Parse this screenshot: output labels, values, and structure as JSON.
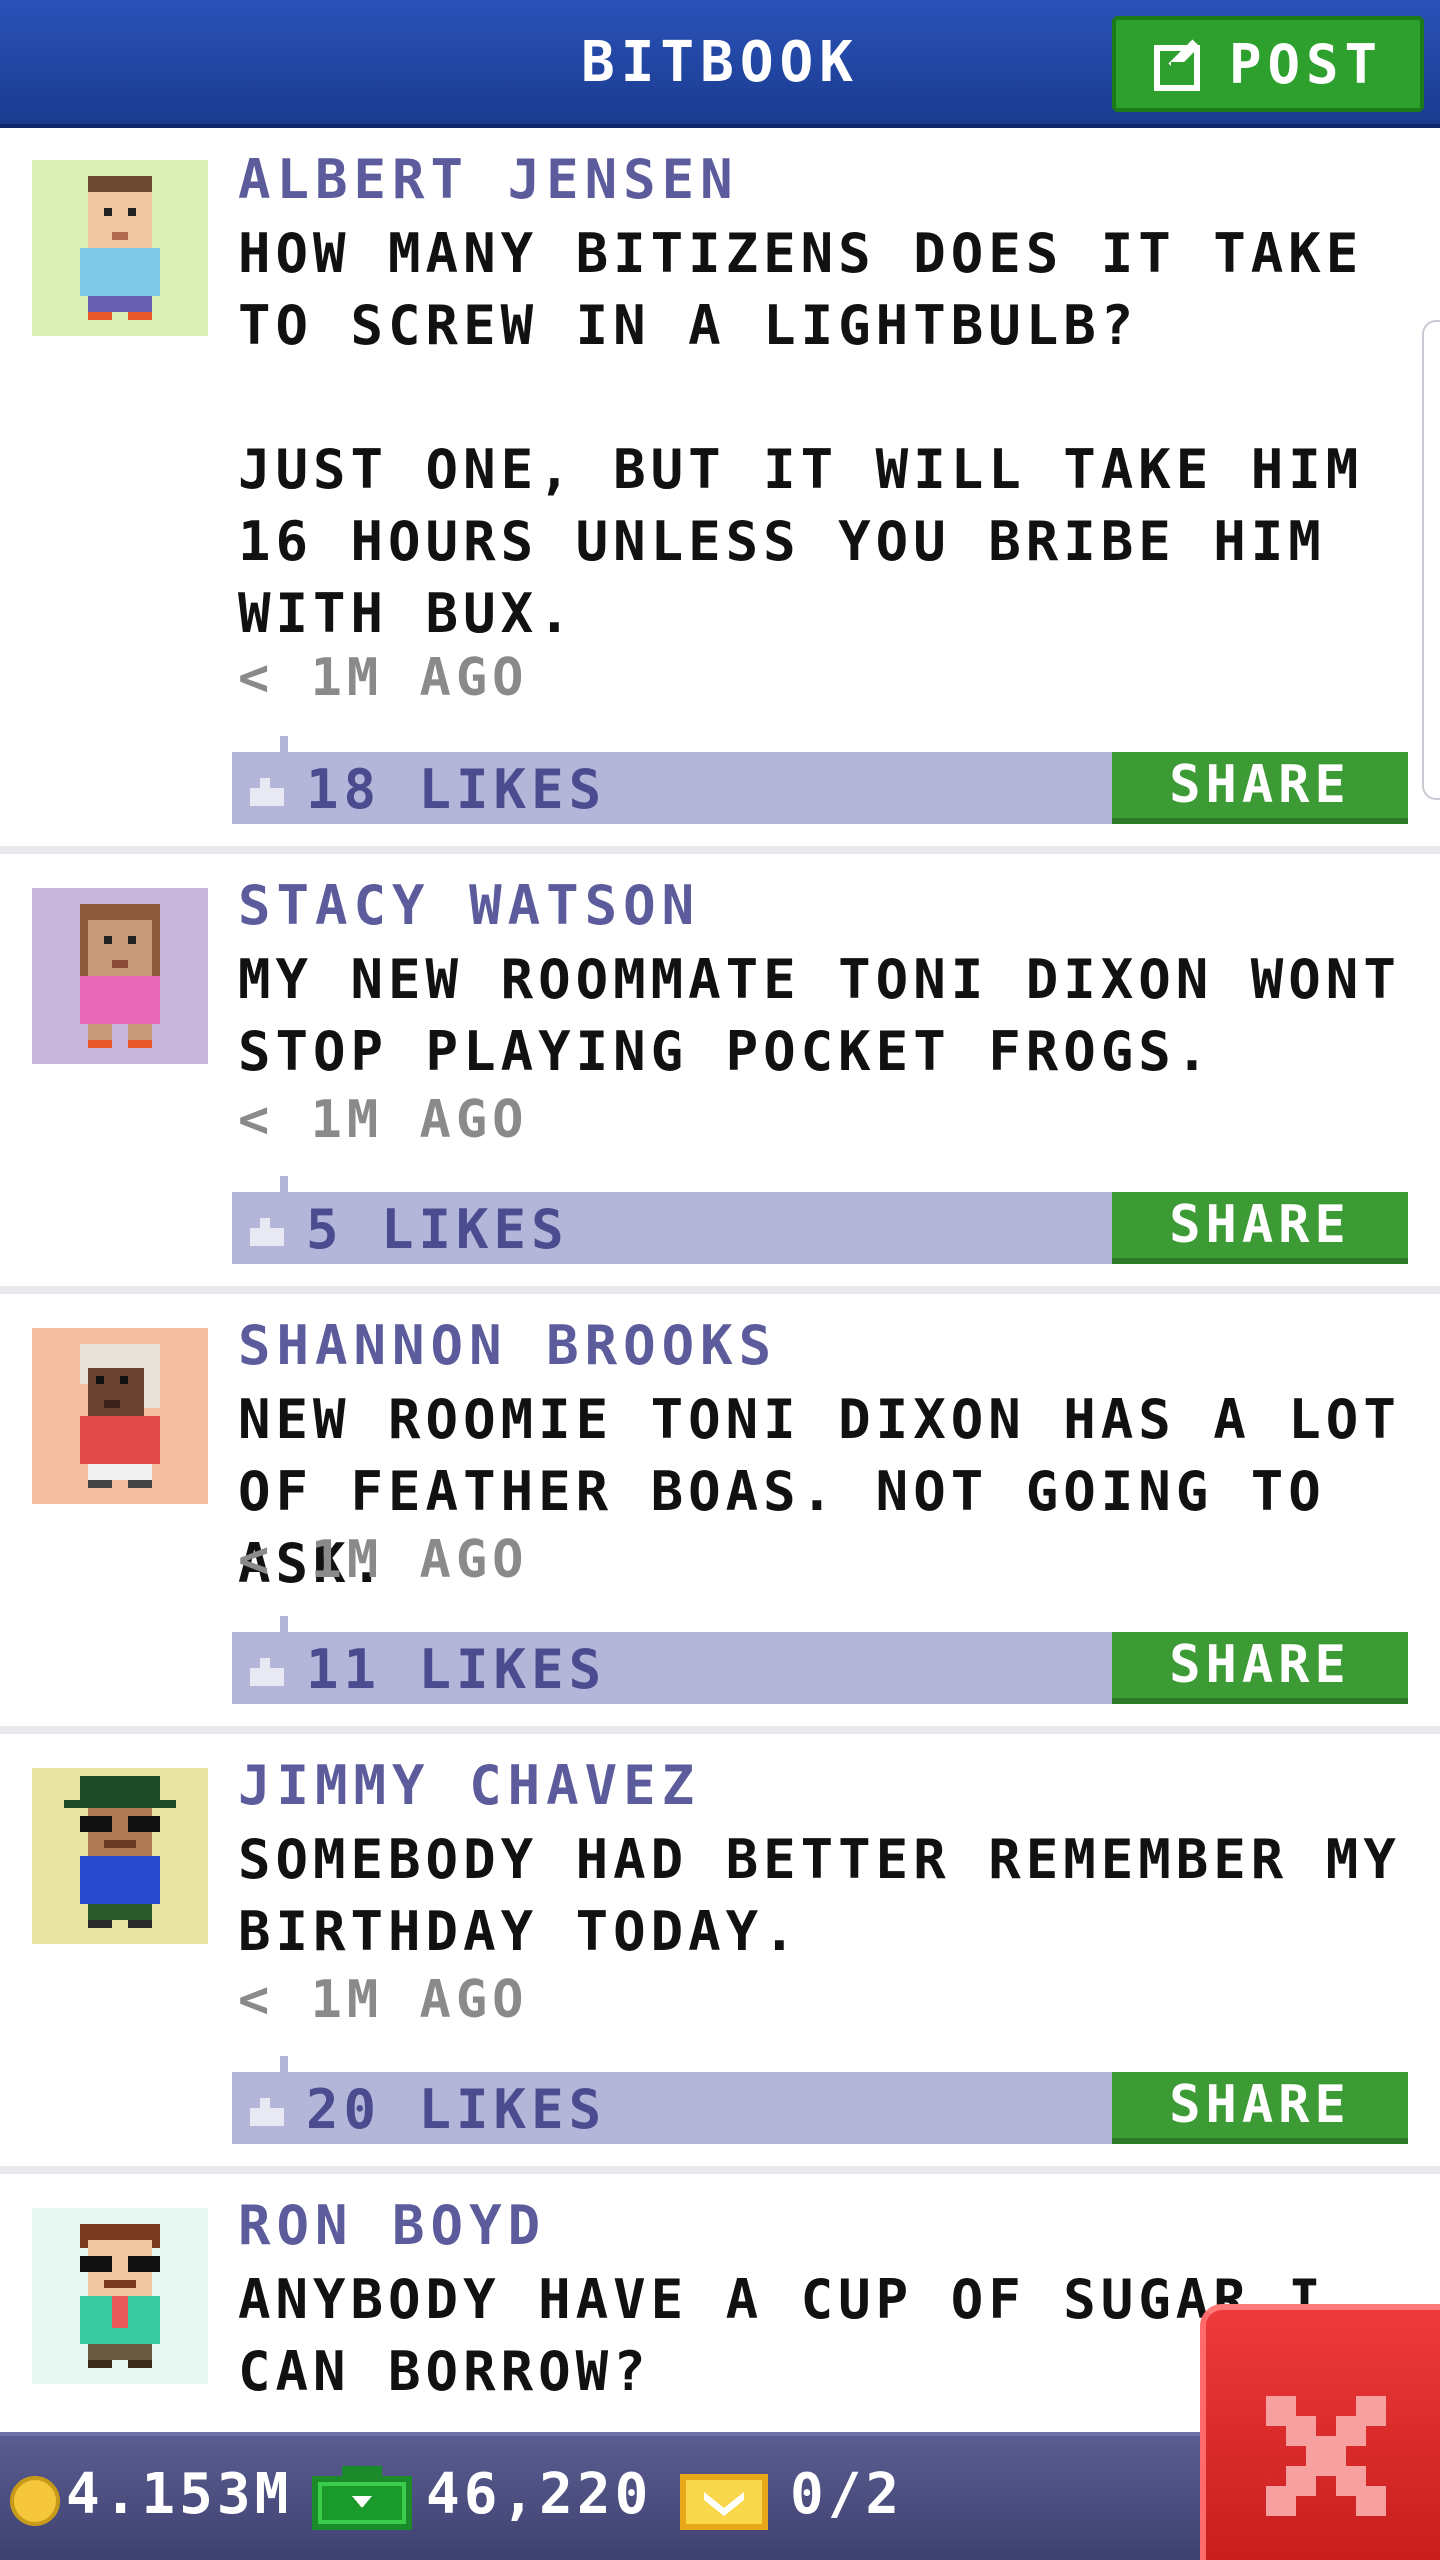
{
  "header": {
    "title": "BITBOOK",
    "post_label": "POST",
    "post_icon": "edit-icon"
  },
  "posts": [
    {
      "author": "ALBERT JENSEN",
      "message": "HOW MANY BITIZENS DOES IT TAKE TO SCREW IN A LIGHTBULB?\n\nJUST ONE, BUT IT WILL TAKE HIM 16 HOURS UNLESS YOU BRIBE HIM WITH BUX.",
      "timestamp": "< 1M AGO",
      "likes": "18 LIKES",
      "share_label": "SHARE",
      "avatar_bg": "#dcefb6"
    },
    {
      "author": "STACY WATSON",
      "message": "MY NEW ROOMMATE TONI DIXON WONT STOP PLAYING POCKET FROGS.",
      "timestamp": "< 1M AGO",
      "likes": "5 LIKES",
      "share_label": "SHARE",
      "avatar_bg": "#c7b5dc"
    },
    {
      "author": "SHANNON BROOKS",
      "message": "NEW ROOMIE TONI DIXON HAS A LOT OF FEATHER BOAS. NOT GOING TO ASK.",
      "timestamp": "< 1M AGO",
      "likes": "11 LIKES",
      "share_label": "SHARE",
      "avatar_bg": "#f4bfa0"
    },
    {
      "author": "JIMMY CHAVEZ",
      "message": "SOMEBODY HAD BETTER REMEMBER MY BIRTHDAY TODAY.",
      "timestamp": "< 1M AGO",
      "likes": "20 LIKES",
      "share_label": "SHARE",
      "avatar_bg": "#e6e3a3"
    },
    {
      "author": "RON BOYD",
      "message": "ANYBODY HAVE A CUP OF SUGAR I CAN BORROW?",
      "avatar_bg": "#eaf8f4"
    }
  ],
  "status_bar": {
    "coins": "4.153M",
    "bux": "46,220",
    "tickets": "0/2",
    "coin_icon": "coin-icon",
    "bux_icon": "bux-icon",
    "ticket_icon": "vip-ticket-icon"
  },
  "close_icon": "close-icon",
  "colors": {
    "header_blue": "#1a3b8f",
    "button_green": "#3d9b35",
    "like_bar": "#b4b6d9",
    "author_text": "#5c5c9c",
    "close_red": "#dd2a2a"
  }
}
